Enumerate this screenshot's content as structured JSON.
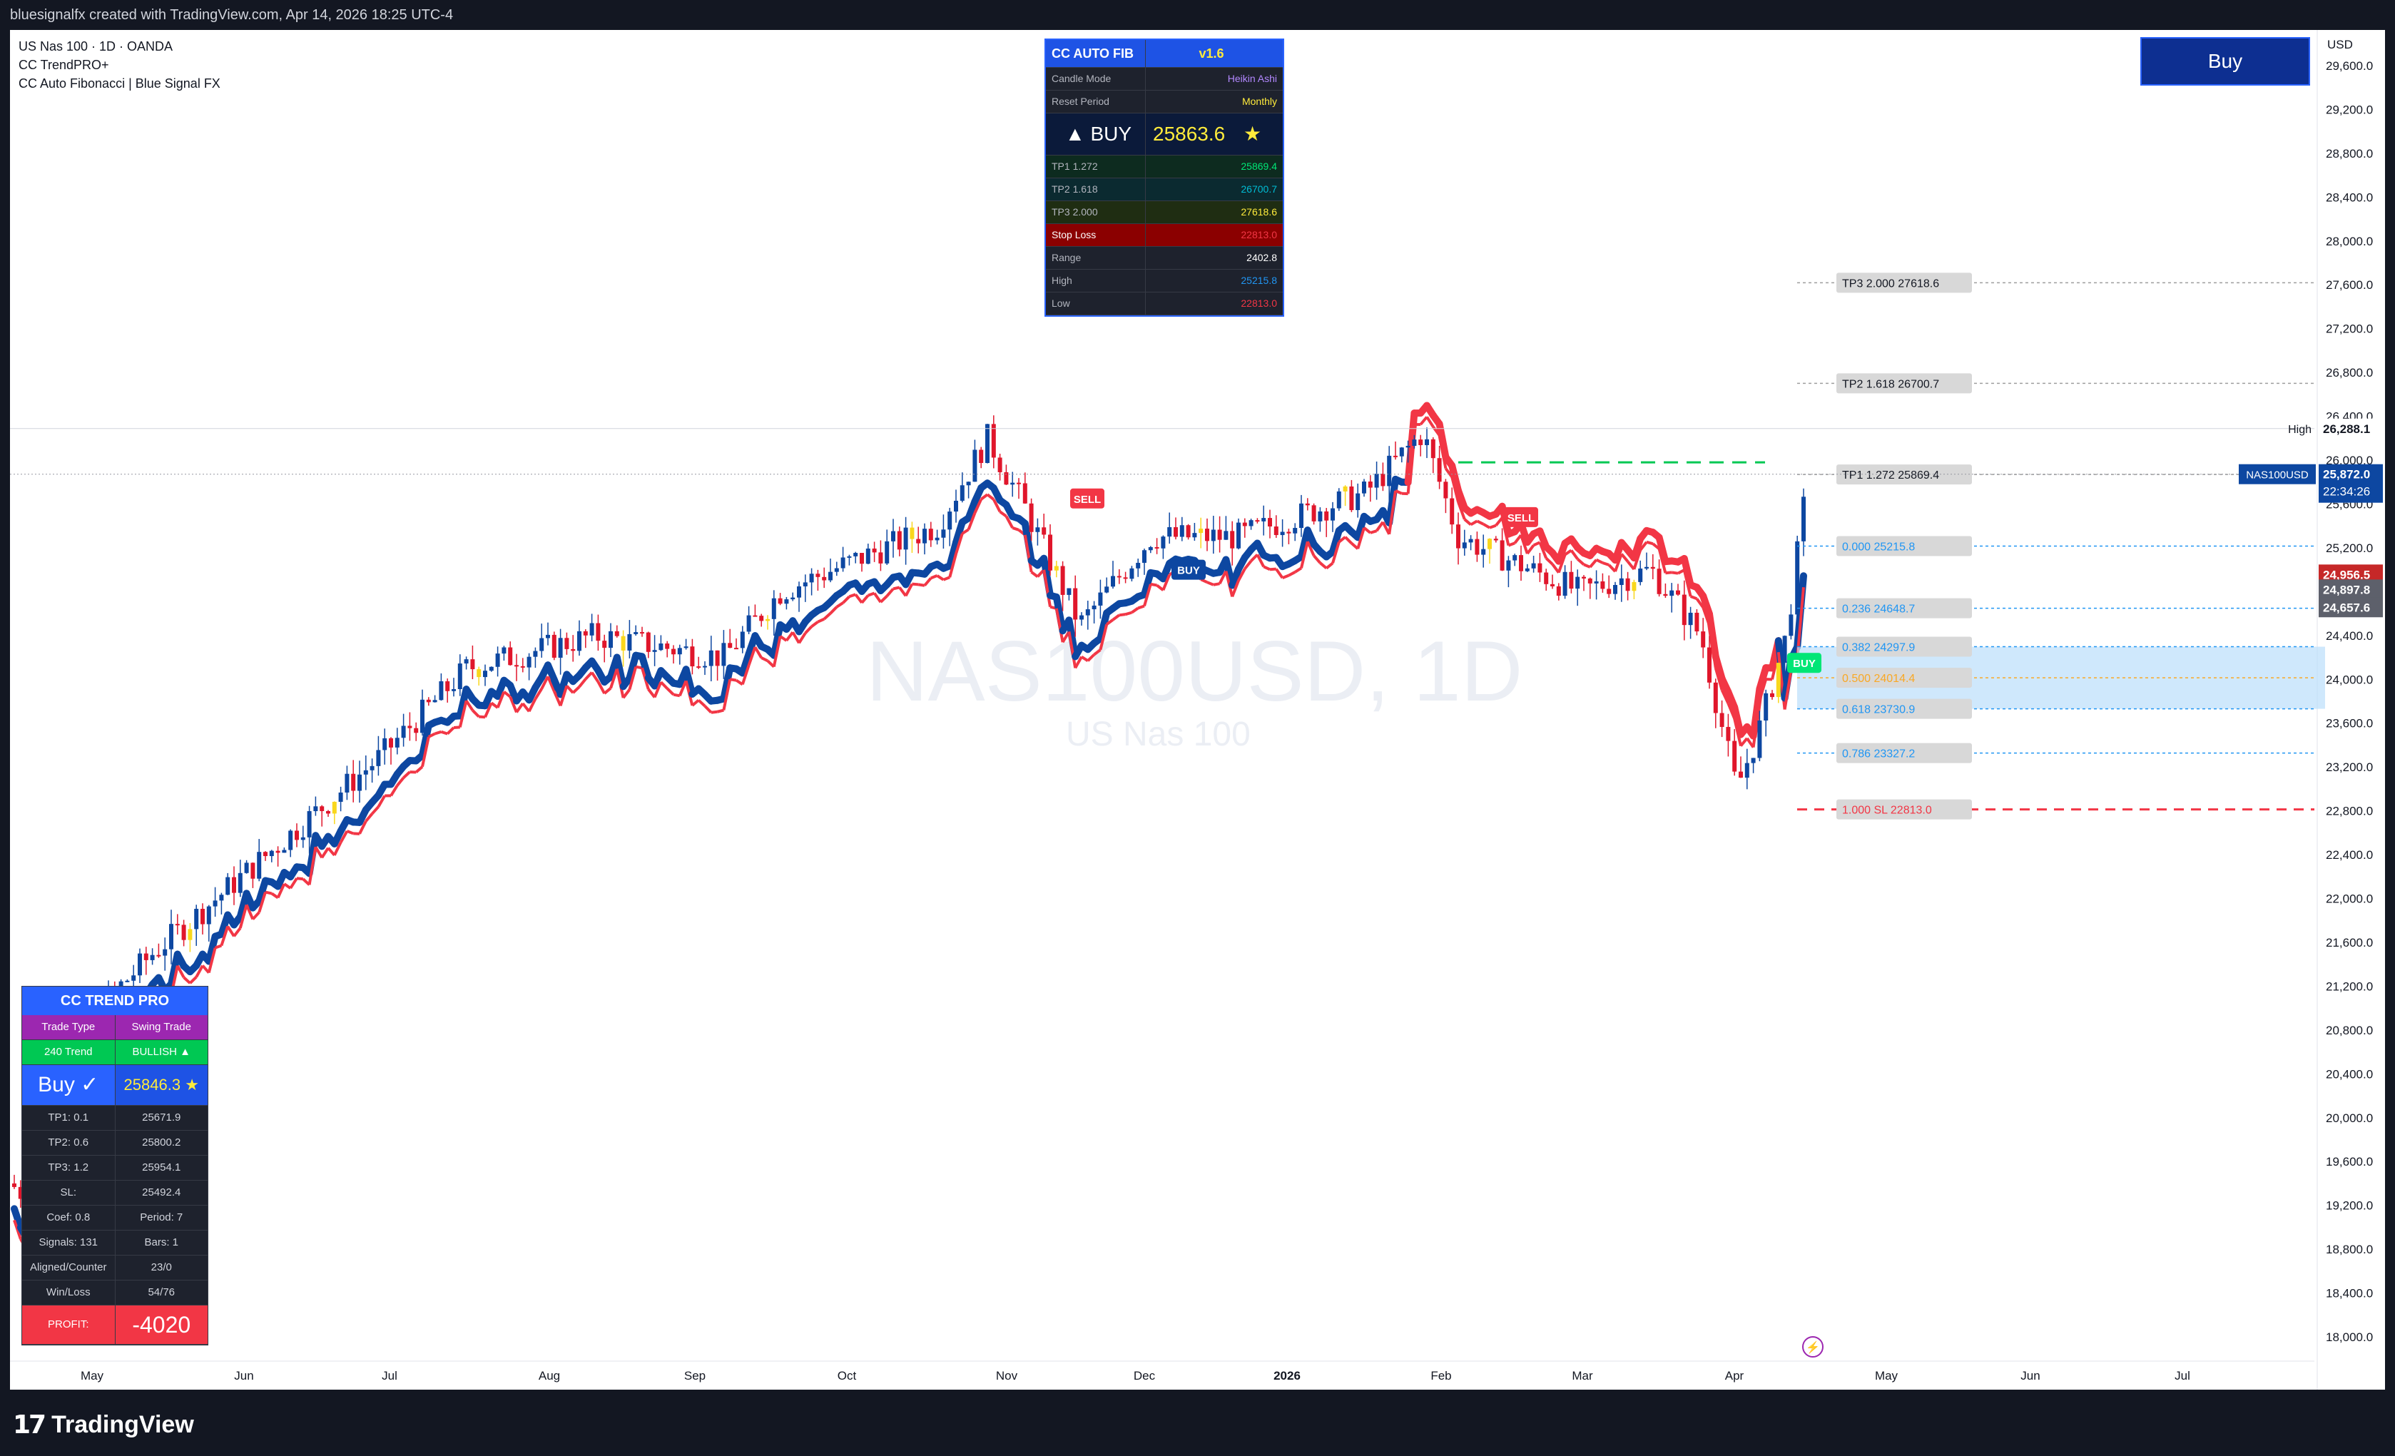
{
  "header": {
    "attribution": "bluesignalfx created with TradingView.com, Apr 14, 2026 18:25 UTC-4"
  },
  "legend": {
    "symbol_line": "US Nas 100 · 1D · OANDA",
    "indicator1": "CC TrendPRO+",
    "indicator2": "CC Auto Fibonacci | Blue Signal FX"
  },
  "watermark": {
    "symbol": "NAS100USD, 1D",
    "name": "US Nas 100"
  },
  "buy_button": {
    "label": "Buy"
  },
  "price_axis": {
    "currency": "USD",
    "ticks": [
      "29,600.0",
      "29,200.0",
      "28,800.0",
      "28,400.0",
      "28,000.0",
      "27,600.0",
      "27,200.0",
      "26,800.0",
      "26,400.0",
      "26,000.0",
      "25,600.0",
      "25,200.0",
      "24,800.0",
      "24,400.0",
      "24,000.0",
      "23,600.0",
      "23,200.0",
      "22,800.0",
      "22,400.0",
      "22,000.0",
      "21,600.0",
      "21,200.0",
      "20,800.0",
      "20,400.0",
      "20,000.0",
      "19,600.0",
      "19,200.0",
      "18,800.0",
      "18,400.0",
      "18,000.0"
    ],
    "high_label": "High",
    "high_value": "26,288.1",
    "symbol_tag": "NAS100USD",
    "last_price": "25,872.0",
    "countdown": "22:34:26",
    "badge_red": "24,956.5",
    "badge_grey1": "24,897.8",
    "badge_grey2": "24,657.6"
  },
  "time_axis": {
    "labels": [
      "May",
      "Jun",
      "Jul",
      "Aug",
      "Sep",
      "Oct",
      "Nov",
      "Dec",
      "2026",
      "Feb",
      "Mar",
      "Apr",
      "May",
      "Jun",
      "Jul"
    ]
  },
  "fib_levels": [
    {
      "label": "TP3  2.000  27618.6",
      "price": 27618.6,
      "color": "#9e9e9e"
    },
    {
      "label": "TP2  1.618  26700.7",
      "price": 26700.7,
      "color": "#9e9e9e"
    },
    {
      "label": "TP1  1.272  25869.4",
      "price": 25869.4,
      "color": "#9e9e9e"
    },
    {
      "label": "0.000  25215.8",
      "price": 25215.8,
      "color": "#2196f3"
    },
    {
      "label": "0.236  24648.7",
      "price": 24648.7,
      "color": "#2196f3"
    },
    {
      "label": "0.382  24297.9",
      "price": 24297.9,
      "color": "#2196f3"
    },
    {
      "label": "0.500  24014.4",
      "price": 24014.4,
      "color": "#f9a825"
    },
    {
      "label": "0.618  23730.9",
      "price": 23730.9,
      "color": "#2196f3"
    },
    {
      "label": "0.786  23327.2",
      "price": 23327.2,
      "color": "#2196f3"
    },
    {
      "label": "1.000  SL  22813.0",
      "price": 22813.0,
      "color": "#f23645"
    }
  ],
  "signals": [
    {
      "label": "SELL",
      "type": "sell"
    },
    {
      "label": "BUY",
      "type": "buy"
    },
    {
      "label": "SELL",
      "type": "sell"
    },
    {
      "label": "BUY",
      "type": "buy-green"
    }
  ],
  "fib_panel": {
    "title": "CC AUTO FIB",
    "version": "v1.6",
    "candle_mode_label": "Candle Mode",
    "candle_mode_value": "Heikin Ashi",
    "reset_label": "Reset Period",
    "reset_value": "Monthly",
    "signal": "▲  BUY",
    "signal_price": "25863.6",
    "rows": [
      {
        "label": "TP1  1.272",
        "value": "25869.4",
        "color": "#00e676",
        "bg": "#0d2b1f"
      },
      {
        "label": "TP2  1.618",
        "value": "26700.7",
        "color": "#00bcd4",
        "bg": "#0b2a30"
      },
      {
        "label": "TP3  2.000",
        "value": "27618.6",
        "color": "#ffeb3b",
        "bg": "#1f2d12"
      },
      {
        "label": "Stop Loss",
        "value": "22813.0",
        "color": "#f23645",
        "bg": "#8b0000"
      },
      {
        "label": "Range",
        "value": "2402.8",
        "color": "#ffffff",
        "bg": "#1e222d"
      },
      {
        "label": "High",
        "value": "25215.8",
        "color": "#2196f3",
        "bg": "#1e222d"
      },
      {
        "label": "Low",
        "value": "22813.0",
        "color": "#f23645",
        "bg": "#1e222d"
      }
    ]
  },
  "trend_panel": {
    "title": "CC TREND PRO",
    "trade_type_label": "Trade Type",
    "trade_type_value": "Swing Trade",
    "trend_label": "240 Trend",
    "trend_value": "BULLISH ▲",
    "signal": "Buy ✓",
    "signal_price": "25846.3",
    "rows": [
      {
        "label": "TP1: 0.1",
        "value": "25671.9"
      },
      {
        "label": "TP2: 0.6",
        "value": "25800.2"
      },
      {
        "label": "TP3: 1.2",
        "value": "25954.1"
      },
      {
        "label": "SL:",
        "value": "25492.4"
      },
      {
        "label": "Coef: 0.8",
        "value": "Period: 7"
      },
      {
        "label": "Signals: 131",
        "value": "Bars: 1"
      },
      {
        "label": "Aligned/Counter",
        "value": "23/0"
      },
      {
        "label": "Win/Loss",
        "value": "54/76"
      }
    ],
    "profit_label": "PROFIT:",
    "profit_value": "-4020"
  },
  "footer": {
    "brand": "TradingView"
  },
  "colors": {
    "buy": "#0d47a1",
    "sell": "#f23645",
    "bull_candle": "#0d47a1",
    "bear_candle": "#e0162b",
    "ha_neutral": "#f9d71c"
  }
}
